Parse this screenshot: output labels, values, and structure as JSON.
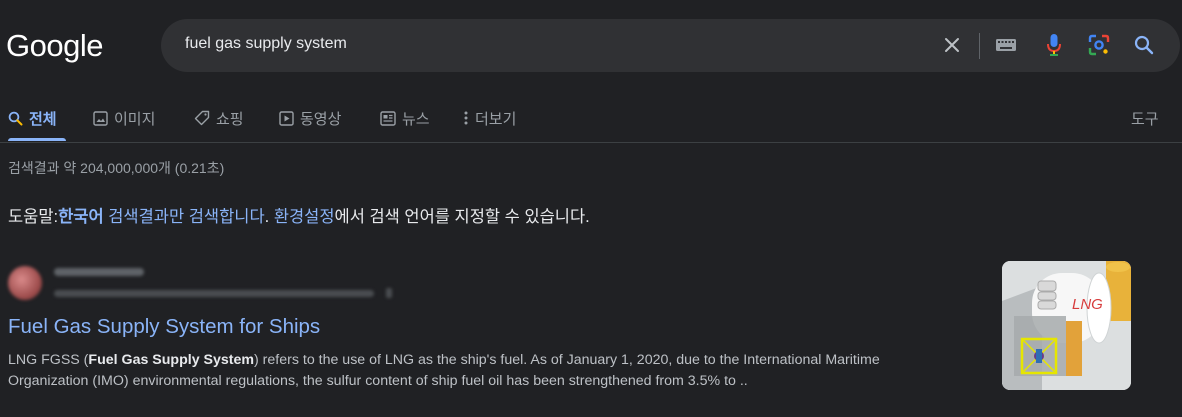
{
  "header": {
    "logo": "Google",
    "query": "fuel gas supply system",
    "icons": [
      "clear-icon",
      "keyboard-icon",
      "microphone-icon",
      "lens-icon",
      "search-icon"
    ]
  },
  "tabs": [
    {
      "label": "전체",
      "icon": "search-icon",
      "active": true
    },
    {
      "label": "이미지",
      "icon": "image-icon"
    },
    {
      "label": "쇼핑",
      "icon": "tag-icon"
    },
    {
      "label": "동영상",
      "icon": "play-icon"
    },
    {
      "label": "뉴스",
      "icon": "news-icon"
    },
    {
      "label": "더보기",
      "icon": "more-vert-icon"
    }
  ],
  "tools_label": "도구",
  "stats": "검색결과 약 204,000,000개 (0.21초)",
  "lang_hint": {
    "prefix": "도움말:",
    "lang": "한국어",
    "mid1": " 검색결과만 검색합니다",
    "dot": ". ",
    "settings": "환경설정",
    "suffix": "에서 검색 언어를 지정할 수 있습니다."
  },
  "result": {
    "title": "Fuel Gas Supply System for Ships",
    "snippet_pre": "LNG FGSS (",
    "snippet_bold": "Fuel Gas Supply System",
    "snippet_post": ") refers to the use of LNG as the ship's fuel. As  of January 1, 2020, due to the International Maritime Organization (IMO) environmental  regulations, the sulfur content of ship fuel oil has been strengthened from 3.5% to ..",
    "thumb_label": "LNG"
  },
  "colors": {
    "background": "#202124",
    "link": "#8ab4f8",
    "text": "#bdc1c6"
  }
}
